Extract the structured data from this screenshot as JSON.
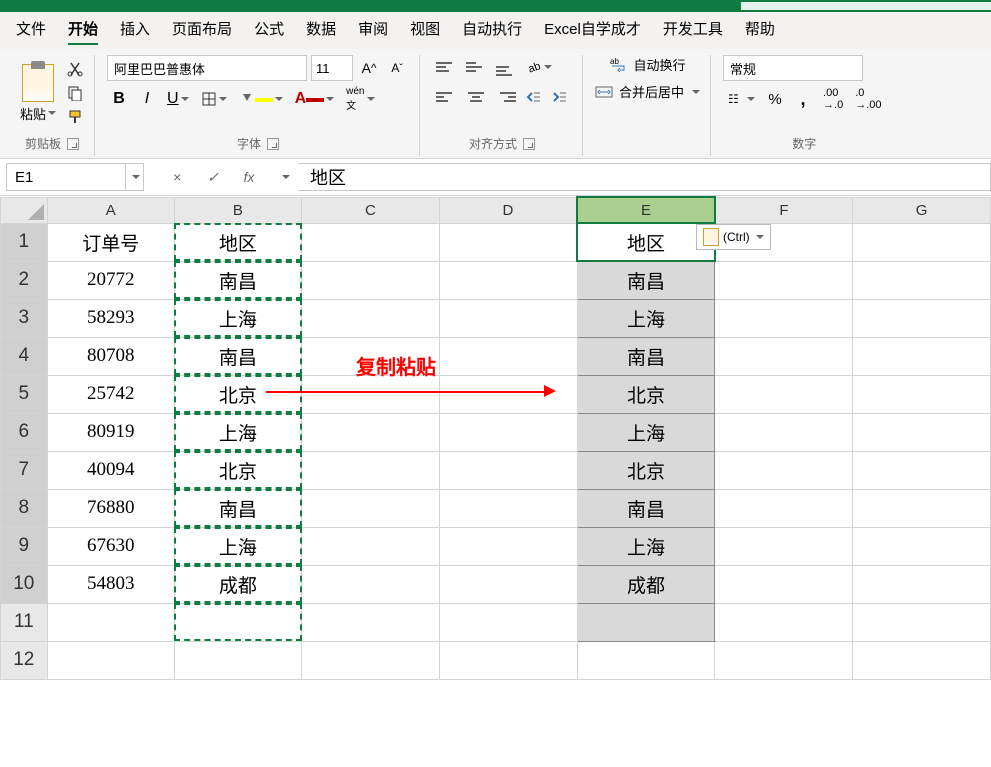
{
  "menubar": [
    "文件",
    "开始",
    "插入",
    "页面布局",
    "公式",
    "数据",
    "审阅",
    "视图",
    "自动执行",
    "Excel自学成才",
    "开发工具",
    "帮助"
  ],
  "menubar_active": 1,
  "ribbon": {
    "clipboard": {
      "paste_label": "粘贴",
      "group": "剪贴板"
    },
    "font": {
      "name": "阿里巴巴普惠体",
      "size": "11",
      "group": "字体"
    },
    "alignment": {
      "group": "对齐方式"
    },
    "merge": {
      "wrap": "自动换行",
      "merge_center": "合并后居中"
    },
    "number": {
      "format": "常规",
      "group": "数字"
    }
  },
  "namebox": "E1",
  "formula": "地区",
  "columns": [
    "A",
    "B",
    "C",
    "D",
    "E",
    "F",
    "G"
  ],
  "rows": [
    {
      "n": 1,
      "A": "订单号",
      "B": "地区",
      "E": "地区"
    },
    {
      "n": 2,
      "A": "20772",
      "B": "南昌",
      "E": "南昌"
    },
    {
      "n": 3,
      "A": "58293",
      "B": "上海",
      "E": "上海"
    },
    {
      "n": 4,
      "A": "80708",
      "B": "南昌",
      "E": "南昌"
    },
    {
      "n": 5,
      "A": "25742",
      "B": "北京",
      "E": "北京"
    },
    {
      "n": 6,
      "A": "80919",
      "B": "上海",
      "E": "上海"
    },
    {
      "n": 7,
      "A": "40094",
      "B": "北京",
      "E": "北京"
    },
    {
      "n": 8,
      "A": "76880",
      "B": "南昌",
      "E": "南昌"
    },
    {
      "n": 9,
      "A": "67630",
      "B": "上海",
      "E": "上海"
    },
    {
      "n": 10,
      "A": "54803",
      "B": "成都",
      "E": "成都"
    },
    {
      "n": 11,
      "A": "",
      "B": "",
      "E": ""
    },
    {
      "n": 12,
      "A": "",
      "B": "",
      "E": ""
    }
  ],
  "annotation": {
    "label": "复制粘贴"
  },
  "paste_option": "(Ctrl)"
}
